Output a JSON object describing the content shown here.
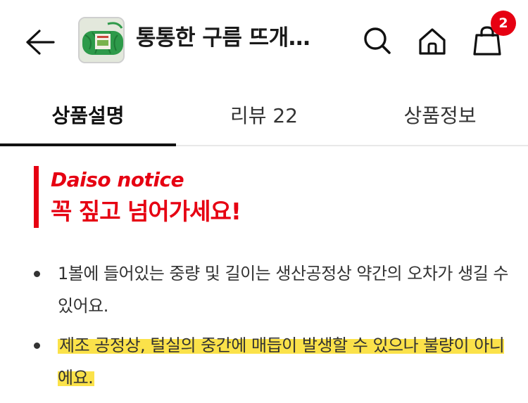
{
  "header": {
    "title": "통통한 구름 뜨개…",
    "back_icon": "arrow-left-icon",
    "thumbnail": "green-yarn-product-thumbnail",
    "cart_count": "2"
  },
  "tabs": [
    {
      "label": "상품설명",
      "active": true
    },
    {
      "label": "리뷰 22",
      "active": false
    },
    {
      "label": "상품정보",
      "active": false
    }
  ],
  "notice": {
    "title_en": "Daiso notice",
    "title_ko": "꼭 짚고 넘어가세요!",
    "accent_color": "#e60012"
  },
  "bullets": [
    {
      "text": "1볼에 들어있는 중량 및 길이는 생산공정상 약간의 오차가 생길 수 있어요.",
      "highlighted": false
    },
    {
      "text": "제조 공정상, 털실의 중간에 매듭이 발생할 수 있으나 불량이 아니에요.",
      "highlighted": true
    }
  ],
  "colors": {
    "brand_red": "#e60012",
    "highlight_yellow": "#fbe24a"
  }
}
